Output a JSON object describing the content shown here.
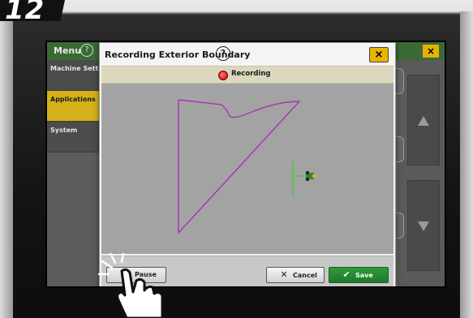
{
  "step": {
    "number": "12"
  },
  "background": {
    "menu_label": "Menu",
    "menu_help": "?",
    "close_label": "×",
    "sidebar": [
      {
        "label": "Machine Settings"
      },
      {
        "label": "Applications",
        "active": true
      },
      {
        "label": "System"
      }
    ]
  },
  "dialog": {
    "title": "Recording Exterior Boundary",
    "help": "?",
    "close": "×",
    "status_label": "Recording",
    "buttons": {
      "pause": "Pause",
      "cancel_icon": "✕",
      "cancel": "Cancel",
      "save_icon": "✔",
      "save": "Save"
    }
  },
  "colors": {
    "brand_green": "#3a6b35",
    "accent_yellow": "#e8b400",
    "boundary_line": "#a832b8",
    "guidance_line": "#4fc24f",
    "save_green": "#2a8c38",
    "recording_red": "#d00000"
  }
}
